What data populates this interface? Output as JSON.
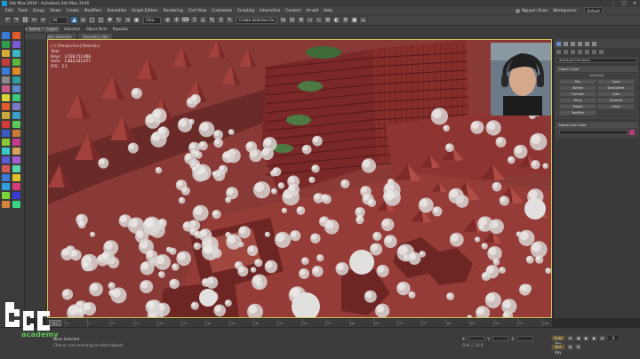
{
  "window": {
    "title": "3ds Max 2016 - Autodesk 3ds Max 2016",
    "buttons": [
      "–",
      "□",
      "✕"
    ]
  },
  "menu": {
    "items": [
      "Edit",
      "Tools",
      "Group",
      "Views",
      "Create",
      "Modifiers",
      "Animation",
      "Graph Editors",
      "Rendering",
      "Civil View",
      "Customize",
      "Scripting",
      "Interactive",
      "Content",
      "Arnold",
      "Help"
    ],
    "workspace_label": "Workspaces:",
    "workspace_value": "Default",
    "user": "Nguyen Xuan"
  },
  "toolbar": {
    "selection_set": "All",
    "view": "View",
    "named_set": "Create Selection Se"
  },
  "ribbon": {
    "tabs": [
      "Modeling",
      "Freeform",
      "Selection",
      "Object Paint",
      "Populate"
    ],
    "tools": [
      "Edit",
      "Modify Selection",
      "Geometry (All)"
    ]
  },
  "viewport_tabs": [
    "Scene",
    "Layer"
  ],
  "viewport": {
    "label": "[+] [Perspective] [Realistic]",
    "stats": [
      {
        "k": "Total",
        "v": ""
      },
      {
        "k": "Polys:",
        "v": "3,528,712,466"
      },
      {
        "k": "Verts:",
        "v": "1,834,331,077"
      },
      {
        "k": "FPS:",
        "v": "1.1"
      }
    ],
    "colors": {
      "ground": "#8a3a36",
      "building": "#7a2a28",
      "trees": "#d8d8d8",
      "border": "#d8c45a"
    }
  },
  "command_panel": {
    "dropdown": "Standard Primitives",
    "object_type_title": "Object Type",
    "autogrid": "AutoGrid",
    "buttons": [
      "Box",
      "Cone",
      "Sphere",
      "GeoSphere",
      "Cylinder",
      "Tube",
      "Torus",
      "Pyramid",
      "Teapot",
      "Plane",
      "TextPlus"
    ],
    "name_color_title": "Name and Color",
    "color": "#b73a72"
  },
  "timeline": {
    "slider_label": "0 / 100",
    "ticks": [
      "0",
      "5",
      "10",
      "15",
      "20",
      "25",
      "30",
      "35",
      "40",
      "45",
      "50",
      "55",
      "60",
      "65",
      "70",
      "75",
      "80",
      "85",
      "90",
      "95",
      "100"
    ]
  },
  "status": {
    "line1": "None Selected",
    "line2": "Click or click-and-drag to select objects",
    "coords_labels": [
      "X:",
      "Y:",
      "Z:"
    ],
    "grid_label": "Grid = 10.0",
    "auto_key": "Auto Key",
    "set_key": "Set Key",
    "frame": "0"
  },
  "logo": {
    "text": "academy"
  }
}
